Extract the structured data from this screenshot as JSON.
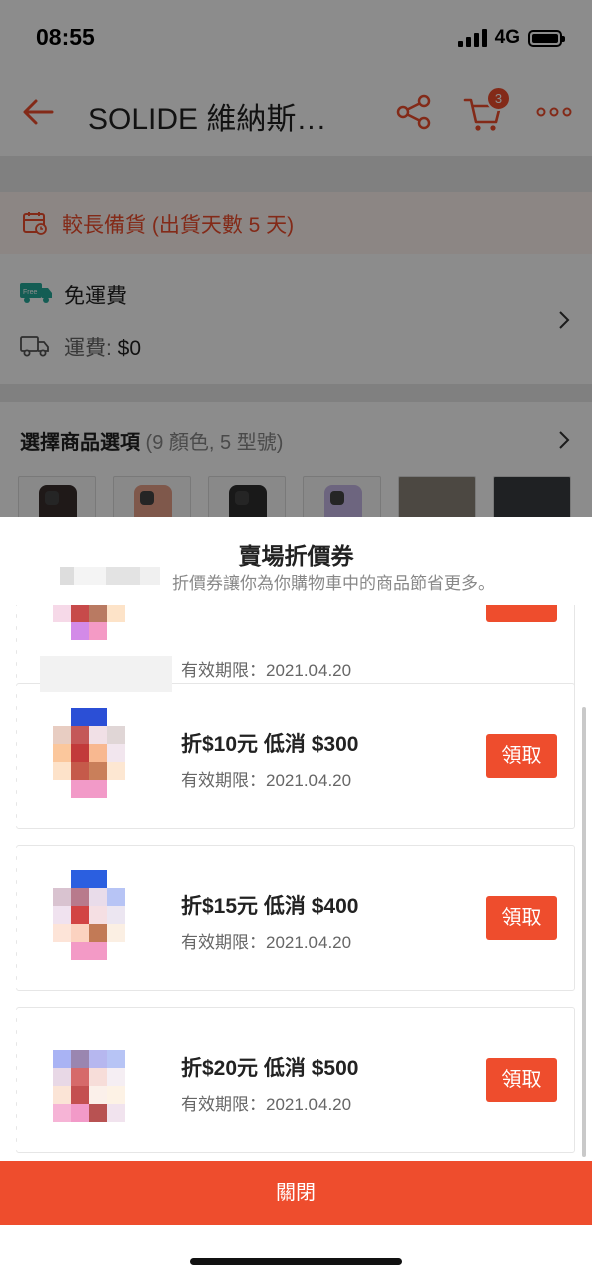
{
  "status_bar": {
    "time": "08:55",
    "network": "4G"
  },
  "nav": {
    "title": "SOLIDE 維納斯…",
    "cart_count": "3"
  },
  "stock": {
    "text": "較長備貨 (出貨天數 5 天)"
  },
  "shipping": {
    "free_badge": "Free",
    "free_label": "免運費",
    "fee_label": "運費: ",
    "fee_value": "$0"
  },
  "options": {
    "title": "選擇商品選項",
    "subtitle": " (9 顏色, 5 型號)"
  },
  "sheet": {
    "title": "賣場折價券",
    "subtitle": "折價券讓你為你購物車中的商品節省更多。",
    "coupons": [
      {
        "main": "",
        "expiry": "有效期限：2021.04.20",
        "claim": ""
      },
      {
        "main": "折$10元 低消 $300",
        "expiry": "有效期限：2021.04.20",
        "claim": "領取"
      },
      {
        "main": "折$15元 低消 $400",
        "expiry": "有效期限：2021.04.20",
        "claim": "領取"
      },
      {
        "main": "折$20元 低消 $500",
        "expiry": "有效期限：2021.04.20",
        "claim": "領取"
      }
    ],
    "close_label": "關閉"
  },
  "colors": {
    "brand": "#ee4d2d"
  },
  "icons": [
    "back-arrow-icon",
    "share-icon",
    "cart-icon",
    "more-icon",
    "calendar-icon",
    "free-shipping-icon",
    "truck-icon",
    "chevron-right-icon"
  ]
}
